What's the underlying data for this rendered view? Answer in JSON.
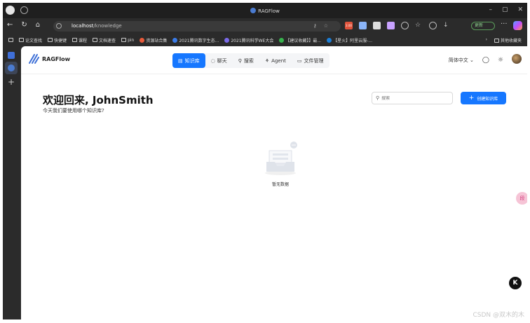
{
  "browser": {
    "tab_title": "RAGFlow",
    "url_host": "localhost",
    "url_path": "/knowledge",
    "update_label": "更新",
    "window_controls": [
      "–",
      "▢",
      "✕"
    ],
    "bookmarks": [
      "论文查找",
      "快捷键",
      "课程",
      "文档速查",
      "pin",
      "资源站合集",
      "2021腾讯数字生态...",
      "2021腾讯科学WE大会",
      "【建议收藏】】最...",
      "【星火】阿里云服-..."
    ],
    "bookmarks_right": "其他收藏夹",
    "extension_badge": "3.00"
  },
  "app": {
    "brand": "RAGFlow",
    "tabs": [
      {
        "label": "知识库",
        "icon": "database-icon",
        "active": true
      },
      {
        "label": "聊天",
        "icon": "chat-icon",
        "active": false
      },
      {
        "label": "搜索",
        "icon": "search-icon",
        "active": false
      },
      {
        "label": "Agent",
        "icon": "agent-icon",
        "active": false
      },
      {
        "label": "文件管理",
        "icon": "folder-icon",
        "active": false
      }
    ],
    "language": "简体中文",
    "welcome": "欢迎回来, JohnSmith",
    "subtitle": "今天我们要使用哪个知识库?",
    "search_placeholder": "搜索",
    "create_button": "创建知识库",
    "empty_text": "暂无数据",
    "float_label": "段",
    "k_label": "K"
  },
  "watermark": "CSDN @双木的木",
  "colors": {
    "accent": "#1677ff"
  }
}
